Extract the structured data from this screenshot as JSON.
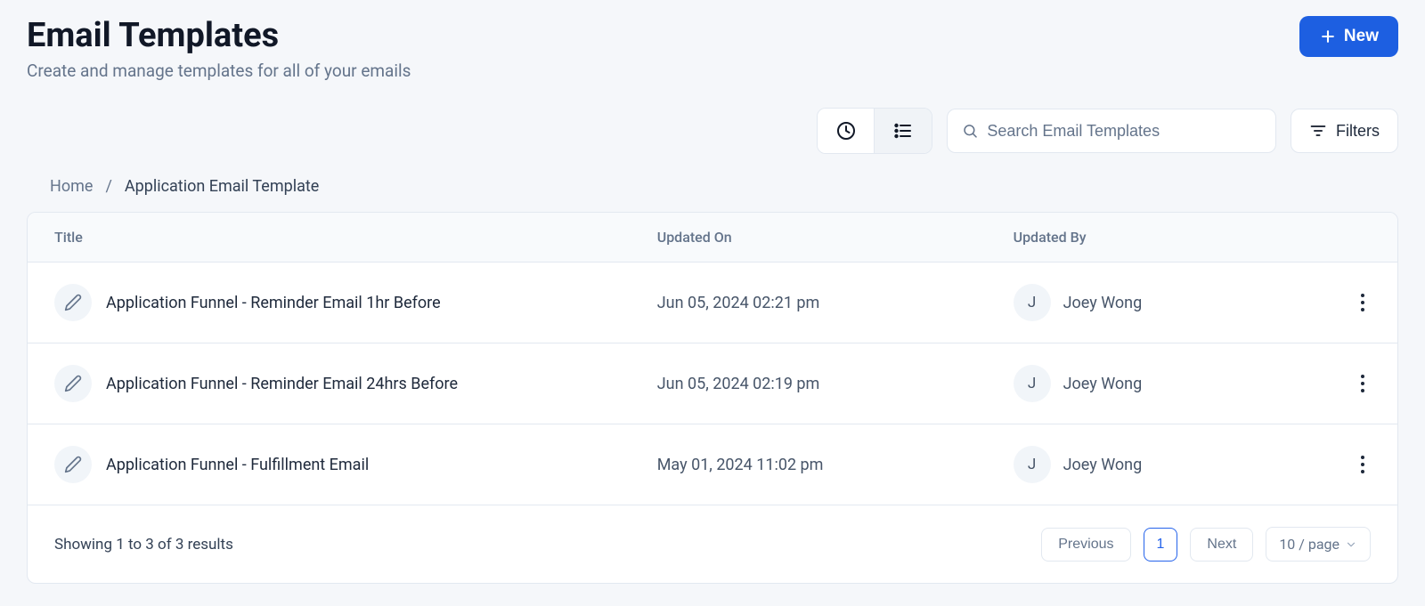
{
  "header": {
    "title": "Email Templates",
    "subtitle": "Create and manage templates for all of your emails",
    "new_button": "New"
  },
  "toolbar": {
    "search_placeholder": "Search Email Templates",
    "filters_label": "Filters"
  },
  "breadcrumb": {
    "home": "Home",
    "separator": "/",
    "current": "Application Email Template"
  },
  "table": {
    "columns": {
      "title": "Title",
      "updated_on": "Updated On",
      "updated_by": "Updated By"
    },
    "rows": [
      {
        "title": "Application Funnel - Reminder Email 1hr Before",
        "updated_on": "Jun 05, 2024 02:21 pm",
        "updated_by_initial": "J",
        "updated_by_name": "Joey Wong"
      },
      {
        "title": "Application Funnel - Reminder Email 24hrs Before",
        "updated_on": "Jun 05, 2024 02:19 pm",
        "updated_by_initial": "J",
        "updated_by_name": "Joey Wong"
      },
      {
        "title": "Application Funnel - Fulfillment Email",
        "updated_on": "May 01, 2024 11:02 pm",
        "updated_by_initial": "J",
        "updated_by_name": "Joey Wong"
      }
    ]
  },
  "footer": {
    "summary": "Showing 1 to 3 of 3 results",
    "previous": "Previous",
    "page": "1",
    "next": "Next",
    "per_page": "10 / page"
  }
}
